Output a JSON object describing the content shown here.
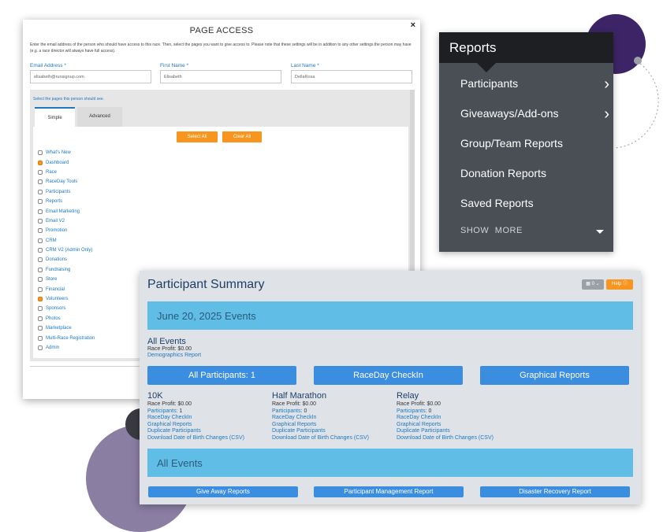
{
  "colors": {
    "accent_orange": "#f7951e",
    "link_blue": "#1d78c1",
    "band_blue": "#5fbde6",
    "button_blue": "#3b8de0",
    "menu_dark": "#4a4e55"
  },
  "page_access": {
    "title": "PAGE ACCESS",
    "close": "×",
    "instructions": "Enter the email address of the person who should have access to this race. Then, select the pages you want to give access to. Please note that these settings will be in addition to any other settings the person may have (e.g. a race director will always have full access).",
    "email_label": "Email Address *",
    "email_value": "elisabeth@runsignup.com",
    "first_label": "First Name *",
    "first_value": "Elisabeth",
    "last_label": "Last Name *",
    "last_value": "DellaRosa",
    "select_text": "Select the pages this person should see.",
    "tabs": [
      "Simple",
      "Advanced"
    ],
    "select_all": "Select All",
    "clear_all": "Clear All",
    "pages": [
      {
        "label": "What's New",
        "checked": false
      },
      {
        "label": "Dashboard",
        "checked": true
      },
      {
        "label": "Race",
        "checked": false
      },
      {
        "label": "RaceDay Tools",
        "checked": false
      },
      {
        "label": "Participants",
        "checked": false
      },
      {
        "label": "Reports",
        "checked": false
      },
      {
        "label": "Email Marketing",
        "checked": false
      },
      {
        "label": "Email V2",
        "checked": false
      },
      {
        "label": "Promotion",
        "checked": false
      },
      {
        "label": "CRM",
        "checked": false
      },
      {
        "label": "CRM V2 (Admin Only)",
        "checked": false
      },
      {
        "label": "Donations",
        "checked": false
      },
      {
        "label": "Fundraising",
        "checked": false
      },
      {
        "label": "Store",
        "checked": false
      },
      {
        "label": "Financial",
        "checked": false
      },
      {
        "label": "Volunteers",
        "checked": true
      },
      {
        "label": "Sponsors",
        "checked": false
      },
      {
        "label": "Photos",
        "checked": false
      },
      {
        "label": "Marketplace",
        "checked": false
      },
      {
        "label": "Multi-Race Registration",
        "checked": false
      },
      {
        "label": "Admin",
        "checked": false
      }
    ]
  },
  "reports_menu": {
    "title": "Reports",
    "items": [
      {
        "label": "Participants",
        "has_submenu": true
      },
      {
        "label": "Giveaways/Add-ons",
        "has_submenu": true
      },
      {
        "label": "Group/Team Reports",
        "has_submenu": false
      },
      {
        "label": "Donation Reports",
        "has_submenu": false
      },
      {
        "label": "Saved Reports",
        "has_submenu": false
      }
    ],
    "show_more": "SHOW MORE"
  },
  "participant_summary": {
    "title": "Participant Summary",
    "count_control": "0",
    "help": "Help",
    "date_band": "June 20, 2025 Events",
    "all_events_heading": "All Events",
    "all_events_profit": "Race Profit: $0.00",
    "demographics": "Demographics Report",
    "big_buttons": [
      "All Participants: 1",
      "RaceDay CheckIn",
      "Graphical Reports"
    ],
    "events": [
      {
        "name": "10K",
        "profit": "Race Profit: $0.00",
        "participants": "Participants: 1"
      },
      {
        "name": "Half Marathon",
        "profit": "Race Profit: $0.00",
        "participants": "Participants: 0"
      },
      {
        "name": "Relay",
        "profit": "Race Profit: $0.00",
        "participants": "Participants: 0"
      }
    ],
    "event_links": [
      "RaceDay CheckIn",
      "Graphical Reports",
      "Duplicate Participants",
      "Download Date of Birth Changes (CSV)"
    ],
    "all_events_band": "All Events",
    "bottom_buttons": [
      "Give Away Reports",
      "Participant Management Report",
      "Disaster Recovery Report"
    ]
  }
}
